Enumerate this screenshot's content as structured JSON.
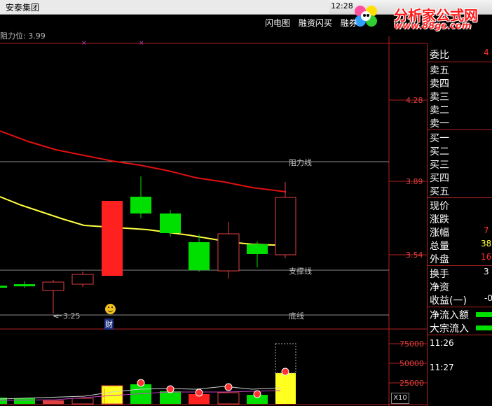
{
  "window": {
    "title": "安泰集团",
    "clock": "12:28"
  },
  "logo": {
    "text": "分析家公式网",
    "url": "www.88gs.com"
  },
  "indicator": {
    "label": "阻力位: 3.99"
  },
  "toolbar": {
    "items": [
      "闪电图",
      "融资闪买",
      "融券"
    ]
  },
  "price_axis": {
    "labels": [
      "4.28",
      "3.89",
      "3.54"
    ]
  },
  "lines": {
    "resistance": "阻力线",
    "support": "支撑线",
    "bottom": "底线",
    "low_value": "3.25"
  },
  "marker": {
    "cai": "财"
  },
  "volume_axis": {
    "labels": [
      "75000",
      "50000",
      "25000"
    ],
    "unit": "X10"
  },
  "side_panel": {
    "weibi": {
      "label": "委比",
      "value": "4"
    },
    "sell": [
      "卖五",
      "卖四",
      "卖三",
      "卖二",
      "卖一"
    ],
    "buy": [
      "买一",
      "买二",
      "买三",
      "买四",
      "买五"
    ],
    "quote": [
      {
        "label": "现价",
        "value": ""
      },
      {
        "label": "涨跌",
        "value": ""
      },
      {
        "label": "涨幅",
        "value": "7"
      },
      {
        "label": "总量",
        "value": "38"
      },
      {
        "label": "外盘",
        "value": "16"
      }
    ],
    "stats": [
      {
        "label": "换手",
        "value": "3"
      },
      {
        "label": "净资",
        "value": ""
      },
      {
        "label": "收益(一)",
        "value": "-0"
      }
    ],
    "flows": [
      "净流入额",
      "大宗流入"
    ],
    "times": [
      "11:26",
      "11:27"
    ]
  },
  "colors": {
    "up": "#ff2020",
    "down": "#00e000",
    "ma_short": "#ffff40",
    "ma_long": "#e01010",
    "grid": "#b02020"
  }
}
